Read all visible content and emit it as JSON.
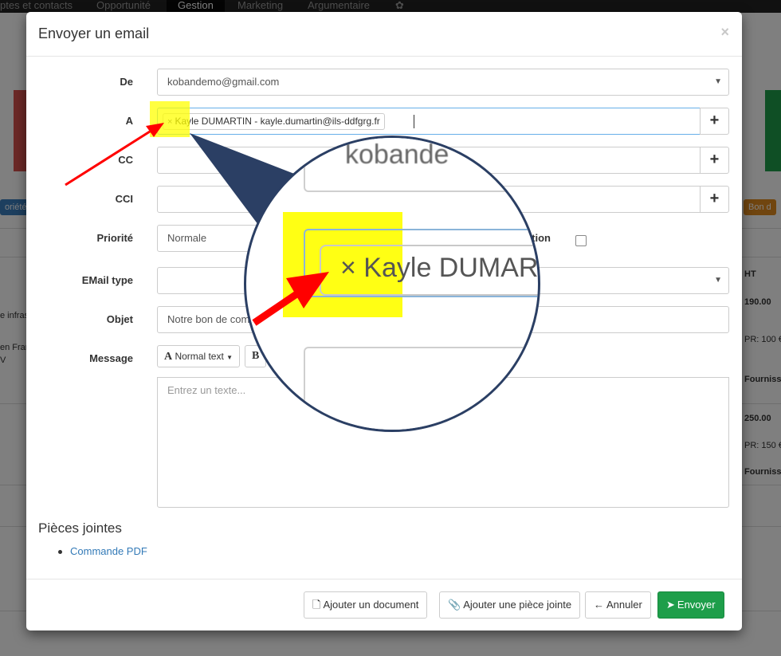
{
  "background": {
    "nav_items": [
      "ptes et contacts",
      "Opportunité",
      "Gestion",
      "Marketing",
      "Argumentaire"
    ],
    "nav_active": "Gestion",
    "left_button": "oriétés",
    "right_button": "Bon d",
    "table_header": "HT",
    "left_texts": [
      "e infras",
      "en Fran",
      "V"
    ],
    "right_values": [
      "190.00",
      "PR: 100 €",
      "Fourniss",
      "250.00",
      "PR: 150 €",
      "Fourniss"
    ],
    "tile_colors": {
      "red": "#d9534f",
      "green": "#1e9e4a",
      "blue": "#3a7ebf",
      "orange": "#e08a1e"
    }
  },
  "modal": {
    "title": "Envoyer un email",
    "close_icon": "×",
    "from": {
      "label": "De",
      "value": "kobandemo@gmail.com"
    },
    "to": {
      "label": "A",
      "tag": "Kayle DUMARTIN - kayle.dumartin@ils-ddfgrg.fr",
      "tag_remove": "×",
      "add_icon": "+"
    },
    "cc": {
      "label": "CC",
      "value": "",
      "add_icon": "+"
    },
    "bcc": {
      "label": "CCI",
      "value": "",
      "add_icon": "+"
    },
    "priority": {
      "label": "Priorité",
      "value": "Normale",
      "confirmation_label": "tion"
    },
    "email_type": {
      "label": "EMail type",
      "value": ""
    },
    "subject": {
      "label": "Objet",
      "value": "Notre bon de com"
    },
    "message": {
      "label": "Message",
      "format_button": "Normal text",
      "bold_button": "B",
      "placeholder": "Entrez un texte..."
    },
    "attachments": {
      "title": "Pièces jointes",
      "items": [
        "Commande PDF"
      ]
    },
    "footer": {
      "add_document": "Ajouter un document",
      "add_attachment": "Ajouter une pièce jointe",
      "cancel": "Annuler",
      "send": "Envoyer"
    }
  },
  "zoom": {
    "text_from": "kobande",
    "text_tag": "× Kayle DUMAR",
    "highlight_color": "#ffff00",
    "arrow_color": "#ff0000",
    "lens_border_color": "#2b3f64"
  }
}
